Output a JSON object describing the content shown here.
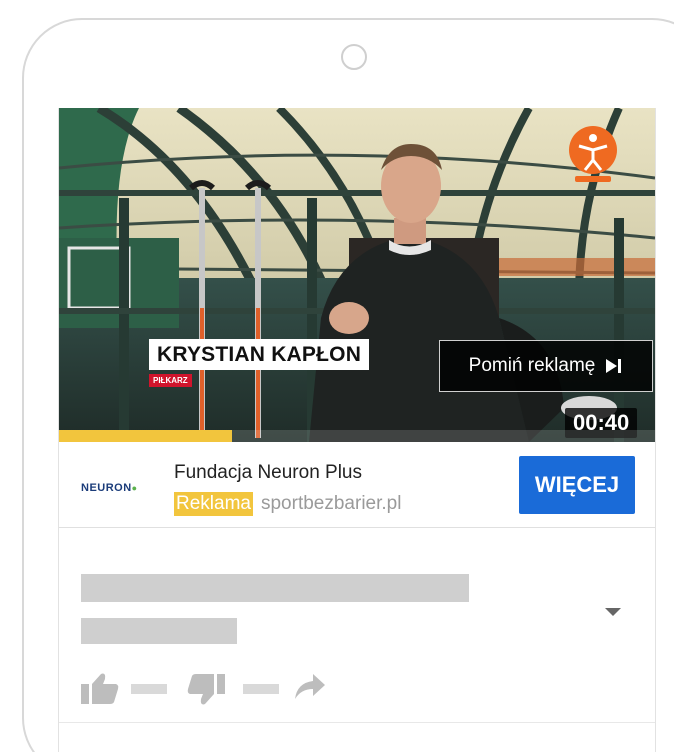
{
  "video": {
    "person_name": "KRYSTIAN KAPŁON",
    "person_role": "PIŁKARZ",
    "skip_label": "Pomiń reklamę",
    "time_remaining": "00:40",
    "progress_percent": 29
  },
  "ad": {
    "advertiser_logo_text": "NEURON",
    "advertiser_name": "Fundacja Neuron Plus",
    "ad_label": "Reklama",
    "domain": "sportbezbarier.pl",
    "cta_label": "WIĘCEJ"
  },
  "colors": {
    "accent_yellow": "#f2c53d",
    "cta_blue": "#1a6bd8",
    "placeholder_gray": "#cfcfcf"
  },
  "icons": {
    "skip": "skip-next-icon",
    "like": "thumbs-up-icon",
    "dislike": "thumbs-down-icon",
    "share": "share-arrow-icon",
    "expand": "chevron-down-icon"
  }
}
